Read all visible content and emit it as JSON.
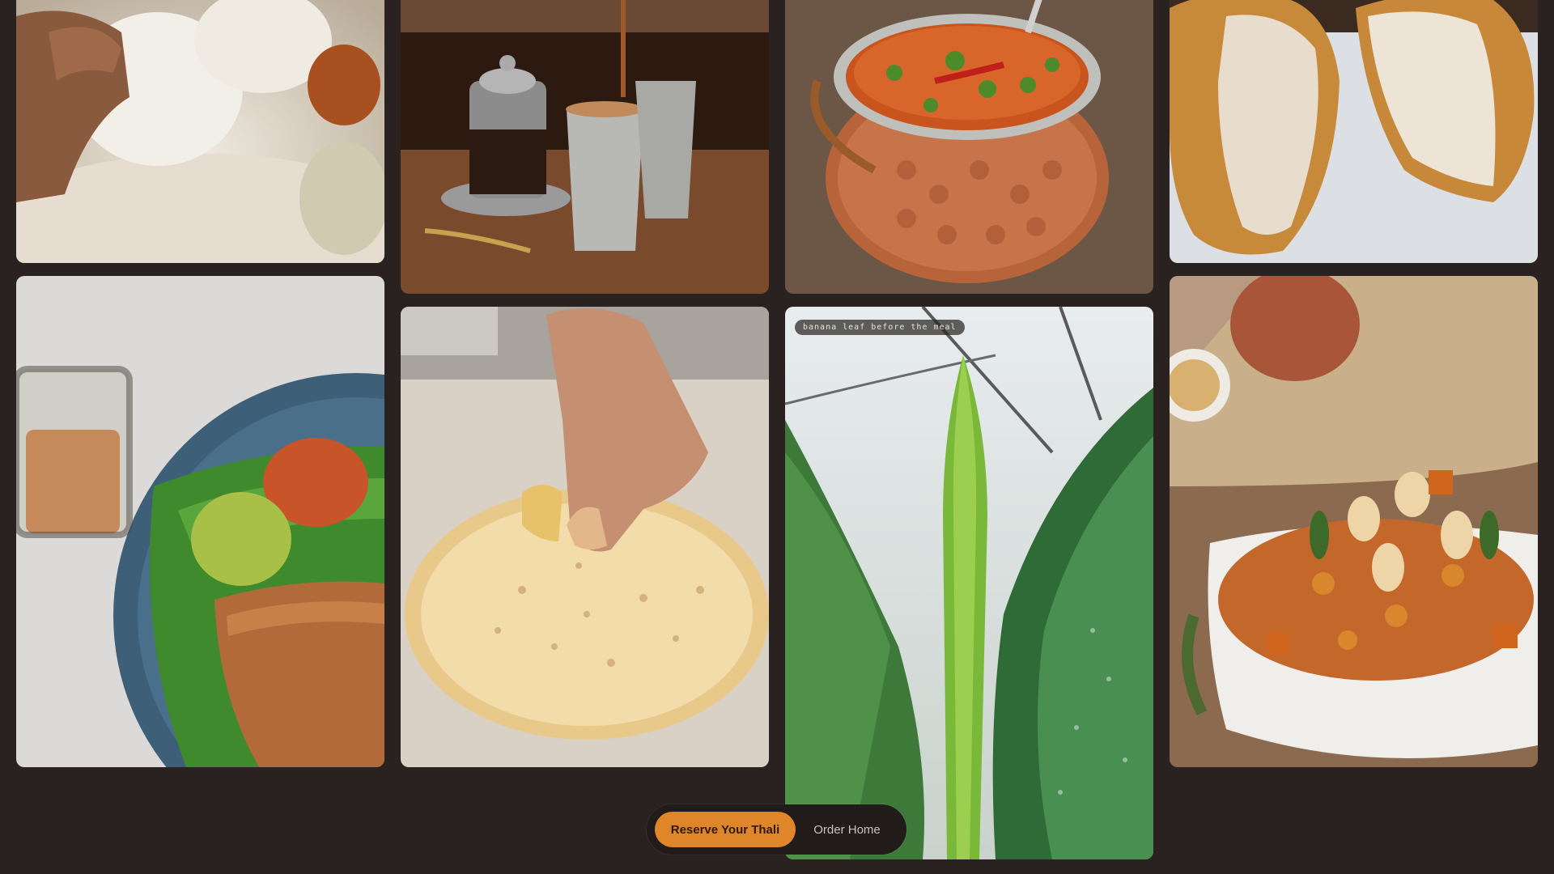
{
  "gallery": {
    "tiles": [
      {
        "name": "idli-photo",
        "subject": "idli with chutneys"
      },
      {
        "name": "dosa-platter-photo",
        "subject": "dosa on banana leaf with chutneys and tea"
      },
      {
        "name": "filter-coffee-photo",
        "subject": "south indian filter coffee"
      },
      {
        "name": "papad-photo",
        "subject": "hand breaking papad"
      },
      {
        "name": "sambar-pot-photo",
        "subject": "sambar in copper pot"
      },
      {
        "name": "banana-leaf-photo",
        "subject": "banana leaf",
        "caption": "banana leaf before the meal"
      },
      {
        "name": "vada-photo",
        "subject": "medu vada"
      },
      {
        "name": "pongal-photo",
        "subject": "vegetable rice with cashews"
      }
    ]
  },
  "cta": {
    "primary_label": "Reserve Your Thali",
    "secondary_label": "Order Home"
  },
  "colors": {
    "background": "#2a2220",
    "accent": "#e0862a",
    "cta_bar": "#211b19"
  }
}
